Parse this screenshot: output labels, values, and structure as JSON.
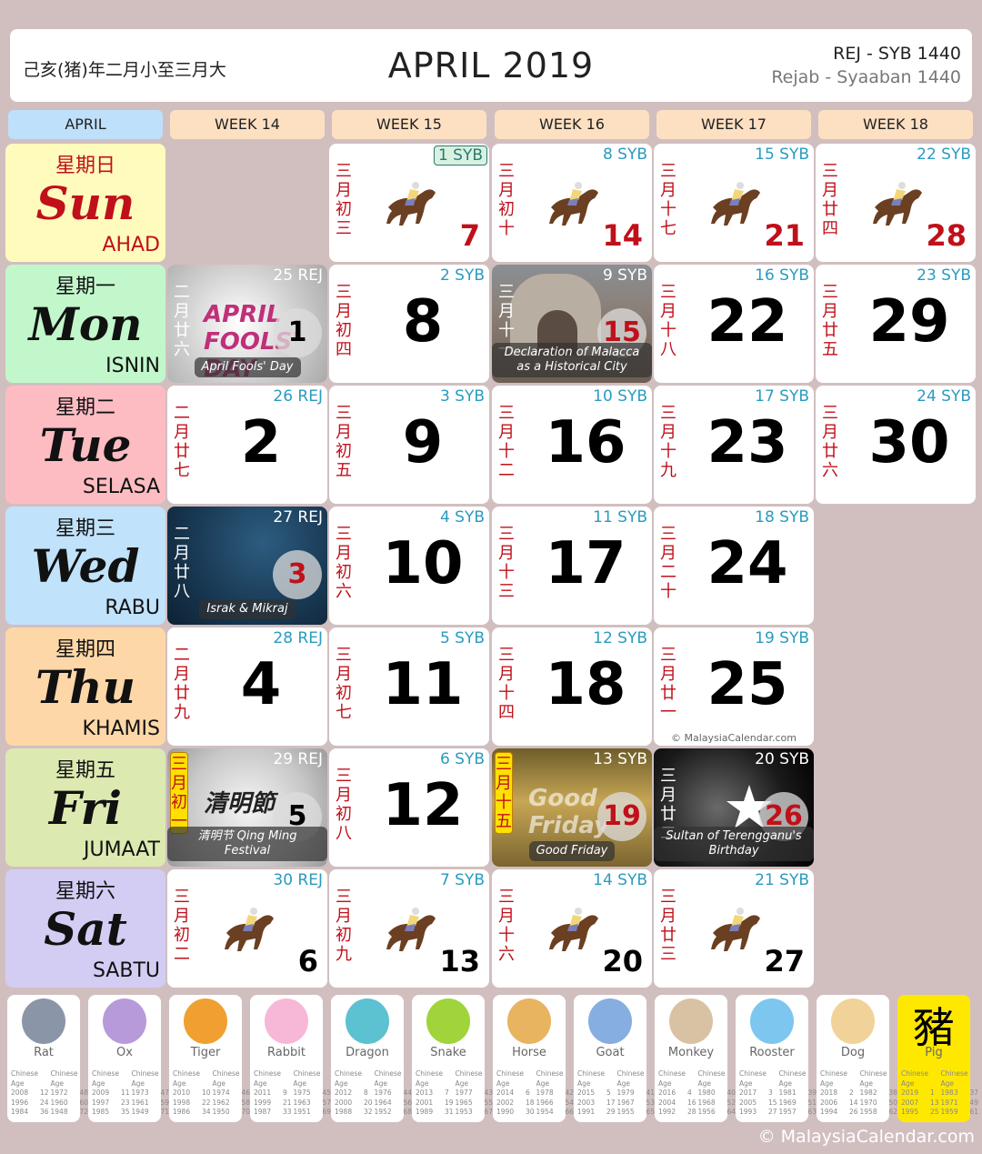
{
  "header": {
    "lunar_range": "己亥(猪)年二月小至三月大",
    "title": "APRIL 2019",
    "hijri_short": "REJ - SYB 1440",
    "hijri_long": "Rejab - Syaaban 1440"
  },
  "columns": {
    "month": "APRIL",
    "weeks": [
      "WEEK 14",
      "WEEK 15",
      "WEEK 16",
      "WEEK 17",
      "WEEK 18"
    ]
  },
  "days": [
    {
      "cn": "星期日",
      "en": "Sun",
      "ms": "AHAD",
      "bg": "#fffbbd",
      "color": "#c0101a"
    },
    {
      "cn": "星期一",
      "en": "Mon",
      "ms": "ISNIN",
      "bg": "#c2f7cc",
      "color": "#111111"
    },
    {
      "cn": "星期二",
      "en": "Tue",
      "ms": "SELASA",
      "bg": "#fdbcc2",
      "color": "#111111"
    },
    {
      "cn": "星期三",
      "en": "Wed",
      "ms": "RABU",
      "bg": "#c1e2fb",
      "color": "#111111"
    },
    {
      "cn": "星期四",
      "en": "Thu",
      "ms": "KHAMIS",
      "bg": "#fed7a8",
      "color": "#111111"
    },
    {
      "cn": "星期五",
      "en": "Fri",
      "ms": "JUMAAT",
      "bg": "#dce9b1",
      "color": "#111111"
    },
    {
      "cn": "星期六",
      "en": "Sat",
      "ms": "SABTU",
      "bg": "#d3cdf4",
      "color": "#111111"
    }
  ],
  "cells": {
    "d1": {
      "day": "1",
      "hijri": "25 REJ",
      "lunar": "二月廿六",
      "event": "April Fools' Day",
      "deco": "APRIL FOOLS' DAY"
    },
    "d2": {
      "day": "2",
      "hijri": "26 REJ",
      "lunar": "二月廿七"
    },
    "d3": {
      "day": "3",
      "hijri": "27 REJ",
      "lunar": "二月廿八",
      "event": "Israk & Mikraj"
    },
    "d4": {
      "day": "4",
      "hijri": "28 REJ",
      "lunar": "二月廿九"
    },
    "d5": {
      "day": "5",
      "hijri": "29 REJ",
      "lunar": "三月初一",
      "event": "清明节 Qing Ming Festival",
      "deco": "清明節"
    },
    "d6": {
      "day": "6",
      "hijri": "30 REJ",
      "lunar": "三月初二"
    },
    "d7": {
      "day": "7",
      "hijri": "1 SYB",
      "lunar": "三月初三"
    },
    "d8": {
      "day": "8",
      "hijri": "2 SYB",
      "lunar": "三月初四"
    },
    "d9": {
      "day": "9",
      "hijri": "3 SYB",
      "lunar": "三月初五"
    },
    "d10": {
      "day": "10",
      "hijri": "4 SYB",
      "lunar": "三月初六"
    },
    "d11": {
      "day": "11",
      "hijri": "5 SYB",
      "lunar": "三月初七"
    },
    "d12": {
      "day": "12",
      "hijri": "6 SYB",
      "lunar": "三月初八"
    },
    "d13": {
      "day": "13",
      "hijri": "7 SYB",
      "lunar": "三月初九"
    },
    "d14": {
      "day": "14",
      "hijri": "8 SYB",
      "lunar": "三月初十"
    },
    "d15": {
      "day": "15",
      "hijri": "9 SYB",
      "lunar": "三月十一",
      "event": "Declaration of Malacca as a Historical City"
    },
    "d16": {
      "day": "16",
      "hijri": "10 SYB",
      "lunar": "三月十二"
    },
    "d17": {
      "day": "17",
      "hijri": "11 SYB",
      "lunar": "三月十三"
    },
    "d18": {
      "day": "18",
      "hijri": "12 SYB",
      "lunar": "三月十四"
    },
    "d19": {
      "day": "19",
      "hijri": "13 SYB",
      "lunar": "三月十五",
      "event": "Good Friday",
      "deco": "Good Friday"
    },
    "d20": {
      "day": "20",
      "hijri": "14 SYB",
      "lunar": "三月十六"
    },
    "d21": {
      "day": "21",
      "hijri": "15 SYB",
      "lunar": "三月十七"
    },
    "d22": {
      "day": "22",
      "hijri": "16 SYB",
      "lunar": "三月十八"
    },
    "d23": {
      "day": "23",
      "hijri": "17 SYB",
      "lunar": "三月十九"
    },
    "d24": {
      "day": "24",
      "hijri": "18 SYB",
      "lunar": "三月二十"
    },
    "d25": {
      "day": "25",
      "hijri": "19 SYB",
      "lunar": "三月廿一",
      "watermark": "© MalaysiaCalendar.com"
    },
    "d26": {
      "day": "26",
      "hijri": "20 SYB",
      "lunar": "三月廿二",
      "event": "Sultan of Terengganu's Birthday"
    },
    "d27": {
      "day": "27",
      "hijri": "21 SYB",
      "lunar": "三月廿三"
    },
    "d28": {
      "day": "28",
      "hijri": "22 SYB",
      "lunar": "三月廿四"
    },
    "d29": {
      "day": "29",
      "hijri": "23 SYB",
      "lunar": "三月廿五"
    },
    "d30": {
      "day": "30",
      "hijri": "24 SYB",
      "lunar": "三月廿六"
    }
  },
  "zodiac": {
    "header_label": [
      "Chinese",
      "Age",
      "Chinese",
      "Age"
    ],
    "animals": [
      {
        "name": "Rat",
        "icon": "rat-icon",
        "rows": [
          [
            "2008",
            "12",
            "1972",
            "48"
          ],
          [
            "1996",
            "24",
            "1960",
            "60"
          ],
          [
            "1984",
            "36",
            "1948",
            "72"
          ]
        ]
      },
      {
        "name": "Ox",
        "icon": "ox-icon",
        "rows": [
          [
            "2009",
            "11",
            "1973",
            "47"
          ],
          [
            "1997",
            "23",
            "1961",
            "59"
          ],
          [
            "1985",
            "35",
            "1949",
            "71"
          ]
        ]
      },
      {
        "name": "Tiger",
        "icon": "tiger-icon",
        "rows": [
          [
            "2010",
            "10",
            "1974",
            "46"
          ],
          [
            "1998",
            "22",
            "1962",
            "58"
          ],
          [
            "1986",
            "34",
            "1950",
            "70"
          ]
        ]
      },
      {
        "name": "Rabbit",
        "icon": "rabbit-icon",
        "rows": [
          [
            "2011",
            "9",
            "1975",
            "45"
          ],
          [
            "1999",
            "21",
            "1963",
            "57"
          ],
          [
            "1987",
            "33",
            "1951",
            "69"
          ]
        ]
      },
      {
        "name": "Dragon",
        "icon": "dragon-icon",
        "rows": [
          [
            "2012",
            "8",
            "1976",
            "44"
          ],
          [
            "2000",
            "20",
            "1964",
            "56"
          ],
          [
            "1988",
            "32",
            "1952",
            "68"
          ]
        ]
      },
      {
        "name": "Snake",
        "icon": "snake-icon",
        "rows": [
          [
            "2013",
            "7",
            "1977",
            "43"
          ],
          [
            "2001",
            "19",
            "1965",
            "55"
          ],
          [
            "1989",
            "31",
            "1953",
            "67"
          ]
        ]
      },
      {
        "name": "Horse",
        "icon": "horse-icon",
        "rows": [
          [
            "2014",
            "6",
            "1978",
            "42"
          ],
          [
            "2002",
            "18",
            "1966",
            "54"
          ],
          [
            "1990",
            "30",
            "1954",
            "66"
          ]
        ]
      },
      {
        "name": "Goat",
        "icon": "goat-icon",
        "rows": [
          [
            "2015",
            "5",
            "1979",
            "41"
          ],
          [
            "2003",
            "17",
            "1967",
            "53"
          ],
          [
            "1991",
            "29",
            "1955",
            "65"
          ]
        ]
      },
      {
        "name": "Monkey",
        "icon": "monkey-icon",
        "rows": [
          [
            "2016",
            "4",
            "1980",
            "40"
          ],
          [
            "2004",
            "16",
            "1968",
            "52"
          ],
          [
            "1992",
            "28",
            "1956",
            "64"
          ]
        ]
      },
      {
        "name": "Rooster",
        "icon": "rooster-icon",
        "rows": [
          [
            "2017",
            "3",
            "1981",
            "39"
          ],
          [
            "2005",
            "15",
            "1969",
            "51"
          ],
          [
            "1993",
            "27",
            "1957",
            "63"
          ]
        ]
      },
      {
        "name": "Dog",
        "icon": "dog-icon",
        "rows": [
          [
            "2018",
            "2",
            "1982",
            "38"
          ],
          [
            "2006",
            "14",
            "1970",
            "50"
          ],
          [
            "1994",
            "26",
            "1958",
            "62"
          ]
        ]
      },
      {
        "name": "Pig",
        "icon": "pig-icon",
        "char": "豬",
        "highlight": true,
        "rows": [
          [
            "2019",
            "1",
            "1983",
            "37"
          ],
          [
            "2007",
            "13",
            "1971",
            "49"
          ],
          [
            "1995",
            "25",
            "1959",
            "61"
          ]
        ]
      }
    ]
  },
  "footer": {
    "copyright": "© MalaysiaCalendar.com"
  },
  "colors": {
    "background": "#d1bfc0",
    "hijri": "#2a9bc0",
    "lunar": "#c0101a",
    "holiday": "#c0101a",
    "pig_highlight": "#ffe800"
  }
}
